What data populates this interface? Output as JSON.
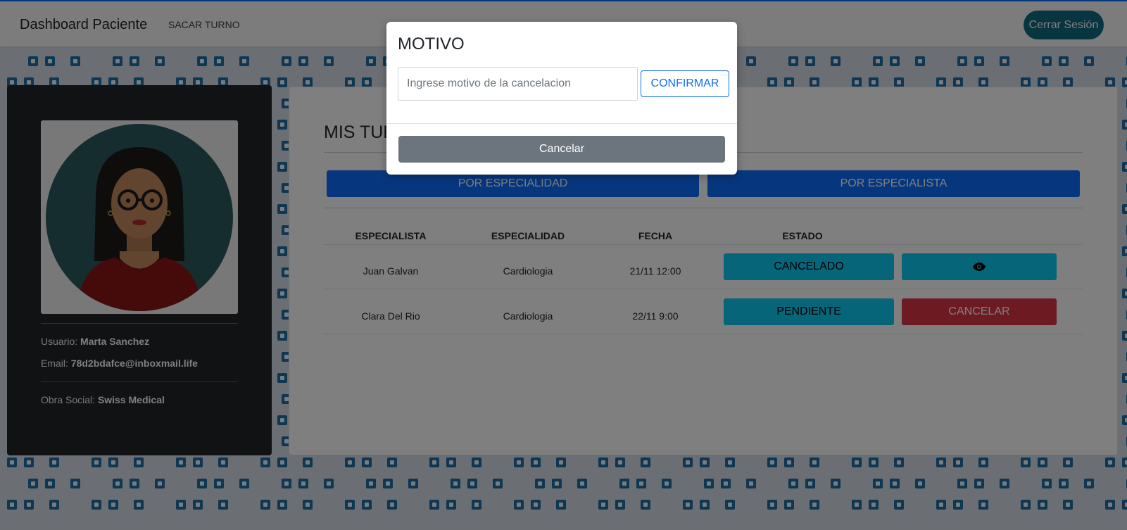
{
  "navbar": {
    "brand": "Dashboard Paciente",
    "link_sacar_turno": "SACAR TURNO",
    "logout_label": "Cerrar Sesión"
  },
  "profile": {
    "user_label": "Usuario:",
    "user_value": "Marta Sanchez",
    "email_label": "Email:",
    "email_value": "78d2bdafce@inboxmail.life",
    "obra_label": "Obra Social:",
    "obra_value": "Swiss Medical"
  },
  "main": {
    "title": "MIS TURNOS",
    "filter_especialidad": "POR ESPECIALIDAD",
    "filter_especialista": "POR ESPECIALISTA",
    "columns": [
      "ESPECIALISTA",
      "ESPECIALIDAD",
      "FECHA",
      "ESTADO"
    ],
    "rows": [
      {
        "especialista": "Juan Galvan",
        "especialidad": "Cardiologia",
        "fecha": "21/11 12:00",
        "estado": "CANCELADO",
        "action": "eye-icon"
      },
      {
        "especialista": "Clara Del Rio",
        "especialidad": "Cardiologia",
        "fecha": "22/11 9:00",
        "estado": "PENDIENTE",
        "action": "CANCELAR"
      }
    ]
  },
  "modal": {
    "title": "MOTIVO",
    "input_placeholder": "Ingrese motivo de la cancelacion",
    "confirm_label": "CONFIRMAR",
    "cancel_label": "Cancelar"
  },
  "colors": {
    "primary": "#0d6efd",
    "info": "#0dcaf0",
    "danger": "#dc3545",
    "secondary": "#6c757d",
    "dark": "#212529",
    "logout": "#0f6b80",
    "pattern": "#1d6fa6"
  }
}
